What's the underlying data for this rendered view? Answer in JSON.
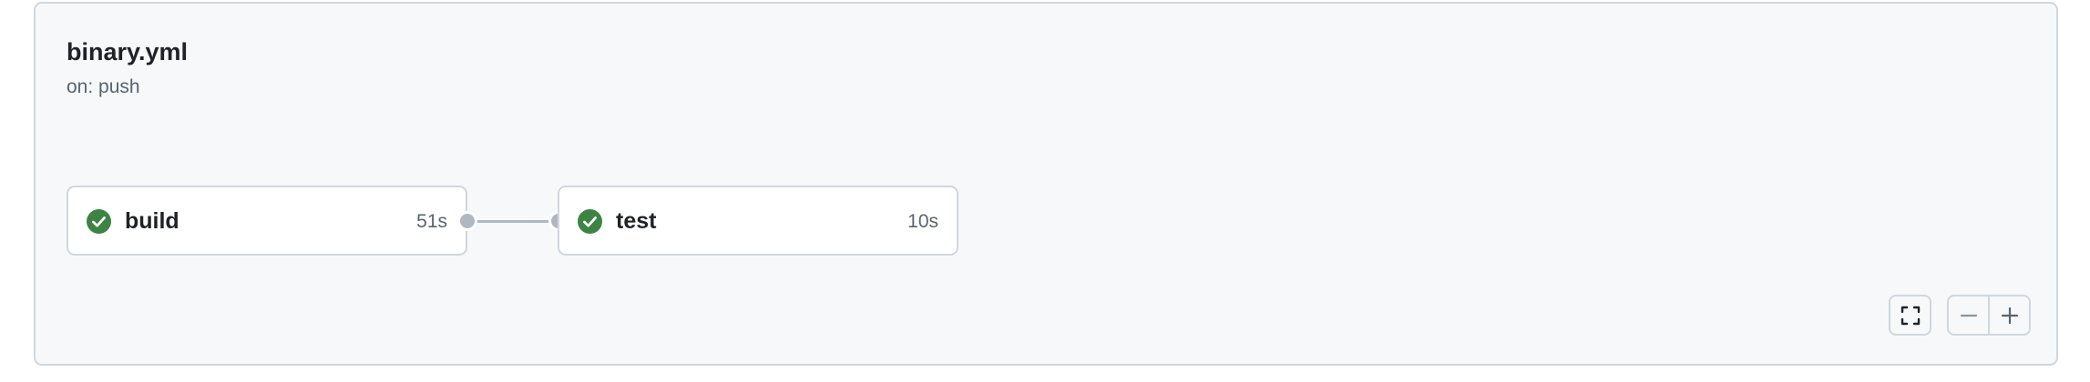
{
  "workflow": {
    "name": "binary.yml",
    "trigger": "on: push"
  },
  "jobs": [
    {
      "name": "build",
      "duration": "51s",
      "status": "success",
      "status_icon": "check-circle-fill-icon"
    },
    {
      "name": "test",
      "duration": "10s",
      "status": "success",
      "status_icon": "check-circle-fill-icon"
    }
  ],
  "controls": {
    "fullscreen_icon": "fullscreen-icon",
    "zoom_out_icon": "minus-icon",
    "zoom_in_icon": "plus-icon"
  },
  "colors": {
    "success": "#1a7f37",
    "border": "#d0d7de",
    "background": "#f6f8fa",
    "connector": "#afb8c1",
    "text_primary": "#1f2328",
    "text_muted": "#59636e"
  }
}
